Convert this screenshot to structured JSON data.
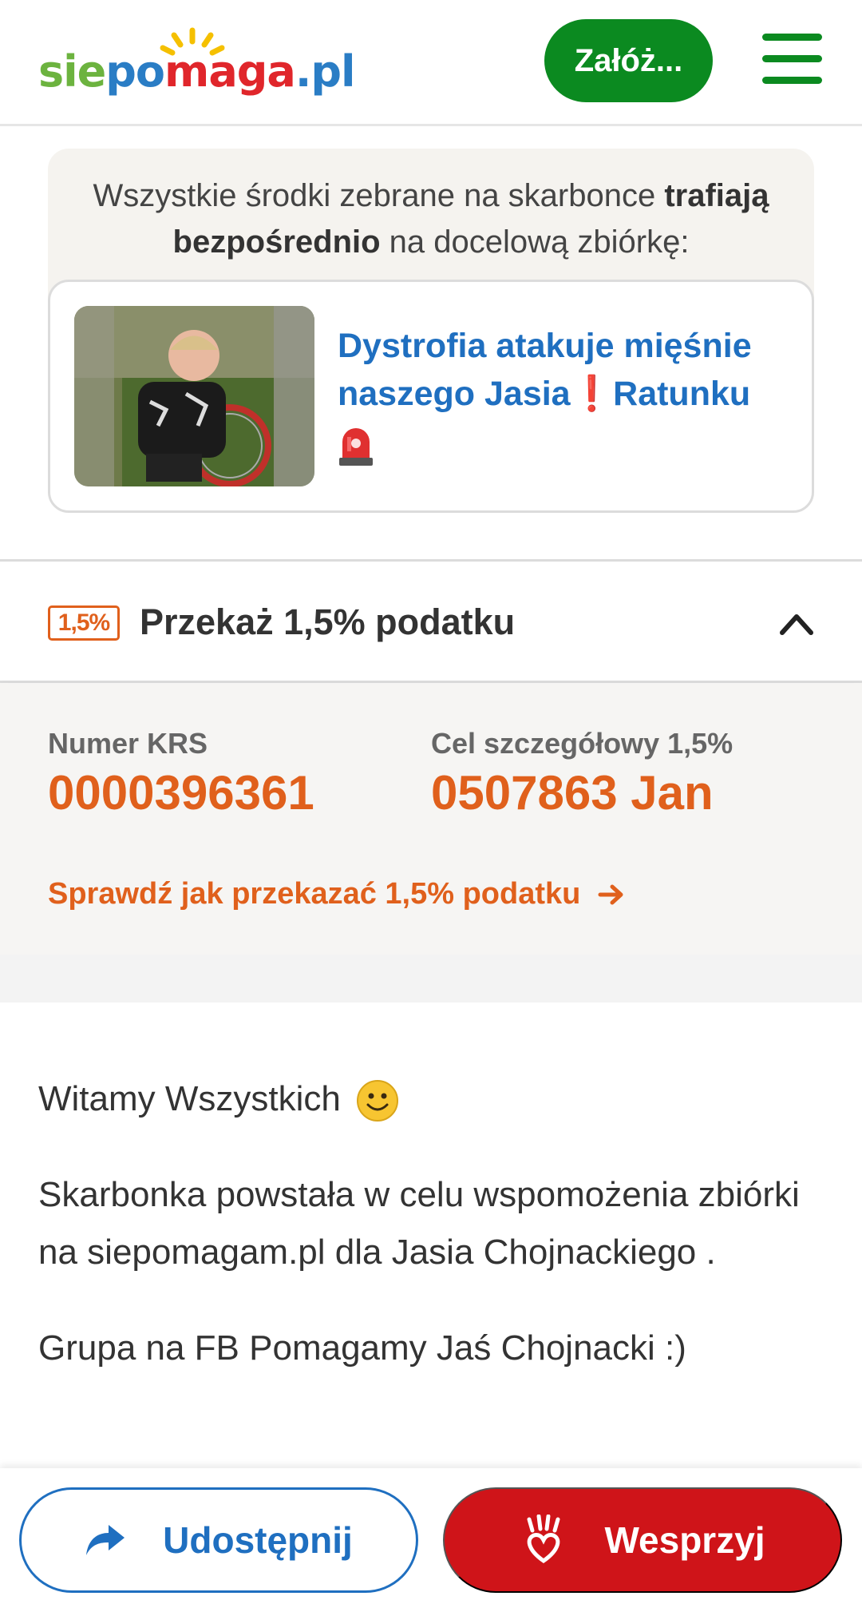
{
  "header": {
    "logo": {
      "part_sie": "sie",
      "part_po": "po",
      "part_maga": "maga",
      "part_pl": ".pl"
    },
    "create_button": "Załóż...",
    "menu_icon": "hamburger-menu-icon"
  },
  "info": {
    "text_prefix": "Wszystkie środki zebrane na skarbonce ",
    "text_bold1": "trafiają",
    "text_bold2": "bezpośrednio",
    "text_suffix": " na docelową zbiórkę:",
    "target_title_1": "Dystrofia atakuje mięśnie naszego Jasia",
    "target_excl": "❗",
    "target_title_2": "Ratunku"
  },
  "tax": {
    "badge": "1,5%",
    "title": "Przekaż 1,5% podatku",
    "krs_label": "Numer KRS",
    "krs_value": "0000396361",
    "cel_label": "Cel szczegółowy 1,5%",
    "cel_value": "0507863 Jan",
    "link": "Sprawdź jak przekazać 1,5% podatku"
  },
  "description": {
    "greeting": "Witamy Wszystkich",
    "paragraph1": "Skarbonka powstała w celu wspomożenia zbiórki na siepomagam.pl dla Jasia Chojnackiego .",
    "paragraph2": "Grupa na FB Pomagamy Jaś Chojnacki :)"
  },
  "bottom": {
    "share_button": "Udostępnij",
    "support_button": "Wesprzyj"
  },
  "colors": {
    "brand_green": "#0b8a20",
    "link_blue": "#1f6fc0",
    "tax_orange": "#e0601c",
    "support_red": "#cf1419"
  }
}
